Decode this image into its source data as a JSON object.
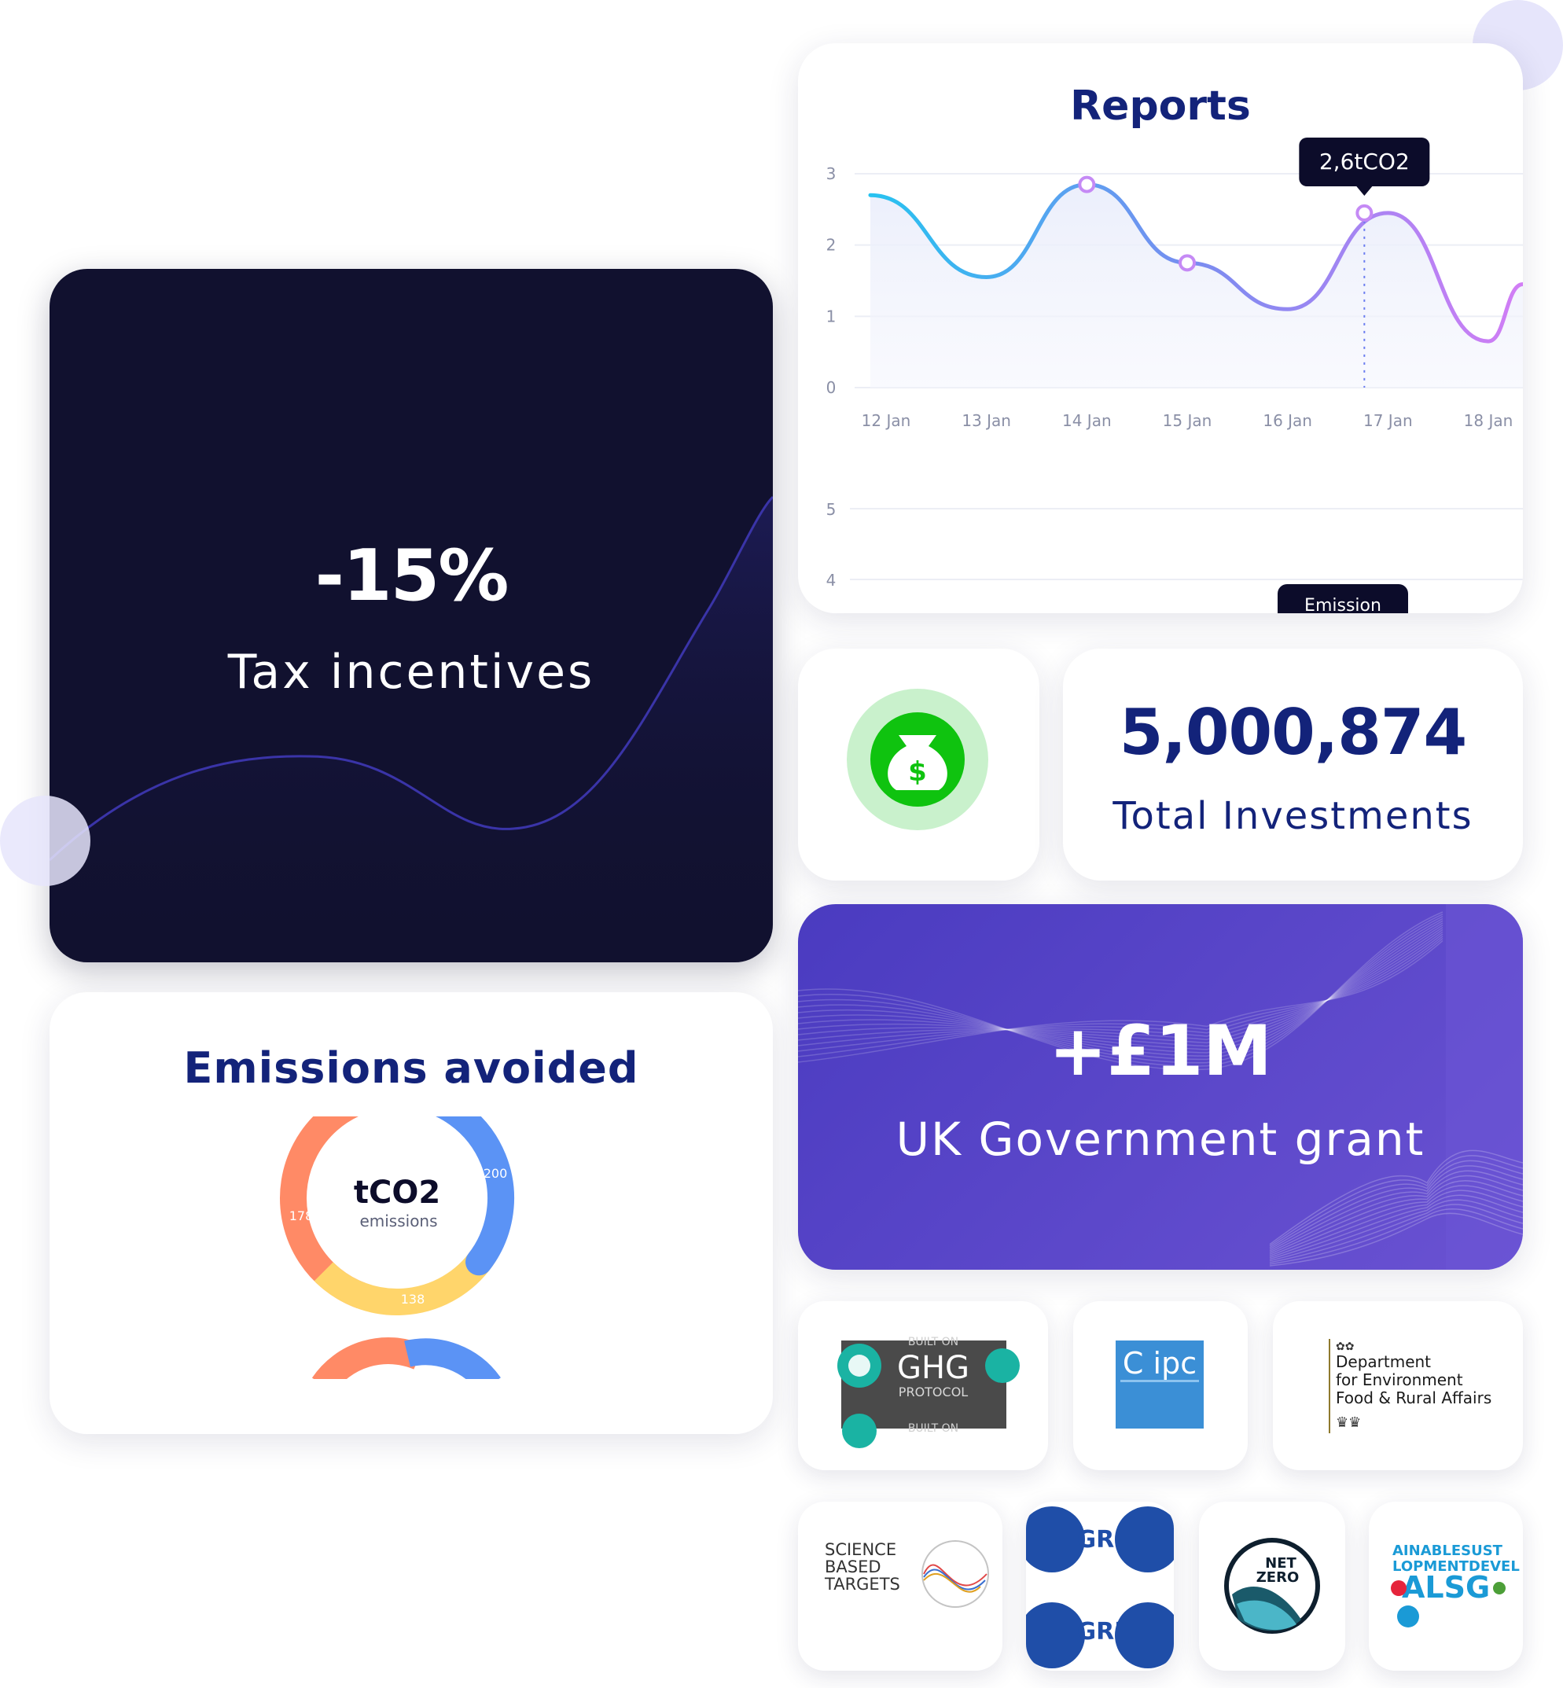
{
  "tax": {
    "value": "-15%",
    "label": "Tax incentives"
  },
  "reports": {
    "title": "Reports",
    "tooltip": "2,6tCO2",
    "y_ticks": [
      "3",
      "2",
      "1",
      "0"
    ],
    "x_ticks": [
      "12 Jan",
      "13 Jan",
      "14 Jan",
      "15 Jan",
      "16 Jan",
      "17 Jan",
      "18 Jan"
    ],
    "lower_y_ticks": [
      "5",
      "4"
    ],
    "lower_badge": "Emission"
  },
  "chart_data": {
    "type": "line",
    "title": "Reports",
    "x": [
      "12 Jan",
      "13 Jan",
      "14 Jan",
      "15 Jan",
      "16 Jan",
      "17 Jan",
      "18 Jan"
    ],
    "series": [
      {
        "values": [
          2.7,
          1.55,
          2.85,
          1.75,
          1.1,
          2.45,
          0.65
        ]
      }
    ],
    "ylim": [
      0,
      3
    ],
    "highlighted_point": {
      "x": "17 Jan",
      "label": "2,6tCO2"
    }
  },
  "investment": {
    "value": "5,000,874",
    "label": "Total Investments",
    "icon": "money-bag-icon"
  },
  "grant": {
    "value": "+£1M",
    "label": "UK Government grant"
  },
  "emissions": {
    "title": "Emissions avoided",
    "center_value": "tCO2",
    "center_label": "emissions",
    "segments": [
      {
        "value": "200",
        "color": "#5b93f5"
      },
      {
        "value": "138",
        "color": "#ffd56b"
      },
      {
        "value": "178",
        "color": "#ff8a66"
      }
    ]
  },
  "logos": {
    "ghg": {
      "line1": "BUILT ON",
      "line2": "GHG",
      "line3": "PROTOCOL",
      "line4": "BUILT ON"
    },
    "ipcc": {
      "text": "C ipc"
    },
    "defra": {
      "line1": "Department",
      "line2": "for Environment",
      "line3": "Food & Rural Affairs"
    },
    "sbti": {
      "line1": "SCIENCE",
      "line2": "BASED",
      "line3": "TARGETS"
    },
    "gri": {
      "text1": "GRI",
      "text2": "GRI"
    },
    "netzero": {
      "line1": "NET",
      "line2": "ZERO"
    },
    "sdg": {
      "line1": "AINABLESUST",
      "line2": "LOPMENTDEVEL",
      "line3": "ALSG"
    }
  }
}
